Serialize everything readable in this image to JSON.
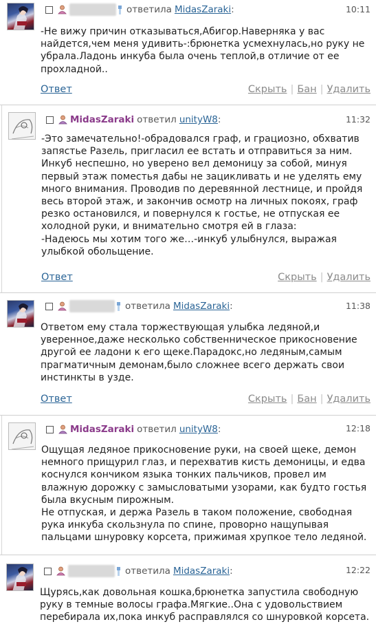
{
  "comments": [
    {
      "time": "10:11",
      "verb": "ответила",
      "target": "MidasZaraki",
      "colon": ":",
      "text": "-Не вижу причин отказываться,Абигор.Наверняка у вас найдется,чем меня удивить-:брюнетка усмехнулась,но руку не убрала.Ладонь инкуба была очень теплой,в отличие от ее прохладной..",
      "actions": {
        "reply": "Ответ",
        "hide": "Скрыть",
        "ban": "Бан",
        "delete": "Удалить"
      }
    },
    {
      "time": "11:32",
      "author": "MidasZaraki",
      "verb": "ответил",
      "target": "unityW8",
      "colon": ":",
      "text": "-Это замечательно!-обрадовался граф, и грациозно, обхватив запястье Разель, пригласил ее встать и отправиться за ним. Инкуб неспешно, но уверено вел демоницу за собой, минуя первый этаж поместья дабы не зацикливать и не уделять ему много внимания. Проводив по деревянной лестнице, и пройдя весь второй этаж, и закончив осмотр на личных покоях, граф резко остановился, и повернулся к гостье, не отпуская ее холодной руки, и внимательно смотря ей в глаза:\n-Надеюсь мы хотим того же…-инкуб улыбнулся, выражая улыбкой обольщение.",
      "actions": {
        "reply": "Ответ",
        "hide": "Скрыть",
        "delete": "Удалить"
      }
    },
    {
      "time": "11:38",
      "verb": "ответила",
      "target": "MidasZaraki",
      "colon": ":",
      "text": "Ответом ему стала торжествующая улыбка ледяной,и уверенное,даже несколько собственническое прикосновение другой ее ладони к его щеке.Парадокс,но ледяным,самым прагматичным демонам,было сложнее всего держать свои инстинкты в узде.",
      "actions": {
        "reply": "Ответ",
        "hide": "Скрыть",
        "ban": "Бан",
        "delete": "Удалить"
      }
    },
    {
      "time": "12:18",
      "author": "MidasZaraki",
      "verb": "ответил",
      "target": "unityW8",
      "colon": ":",
      "text": "Ощущая ледяное прикосновение руки, на своей щеке, демон немного прищурил глаз, и перехватив кисть демоницы, и едва коснулся кончиком языка тонких пальчиков, провел им влажную дорожку с замысловатыми узорами, как будто гостья была вкусным пирожным.\nНе отпуская, и держа Разель в таком положение, свободная рука инкуба скользнула по спине, проворно нащупывая пальцами шнуровку корсета, прижимая хрупкое тело ледяной.",
      "actions": {}
    },
    {
      "time": "12:22",
      "verb": "ответила",
      "target": "MidasZaraki",
      "colon": ":",
      "text": "Щурясь,как довольная кошка,брюнетка запустила свободную руку в темные волосы графа.Мягкие..Она с удовольствием перебирала их,пока инкуб расправлялся со шнуровкой корсета.",
      "actions": {}
    }
  ],
  "colors": {
    "link": "#2a6496",
    "author": "#8a3a8a",
    "muted": "#8a8a8a"
  }
}
